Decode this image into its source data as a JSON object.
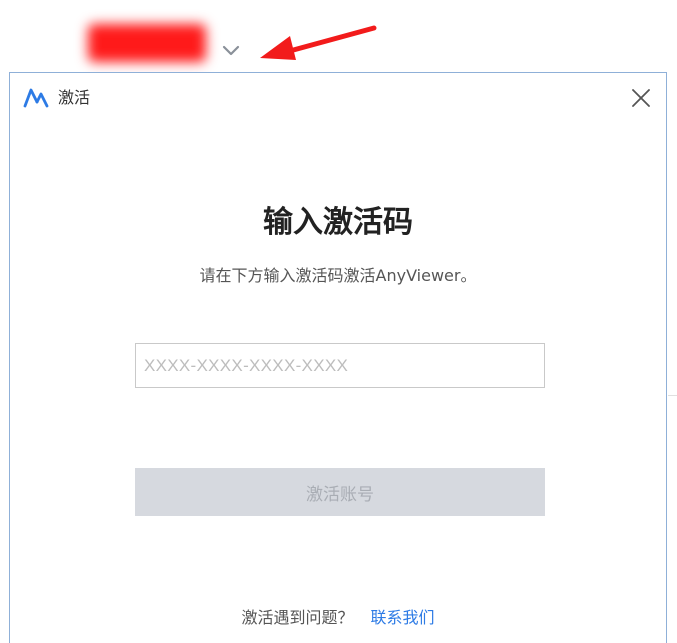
{
  "dialog": {
    "title": "激活",
    "heading": "输入激活码",
    "subtitle": "请在下方输入激活码激活AnyViewer。",
    "code_input": {
      "placeholder": "XXXX-XXXX-XXXX-XXXX",
      "value": ""
    },
    "activate_button_label": "激活账号",
    "help_text": "激活遇到问题？",
    "contact_link_label": "联系我们"
  },
  "colors": {
    "accent": "#2d7be5",
    "dialog_border": "#8fb0d8",
    "button_disabled_bg": "#d6d9df",
    "button_disabled_text": "#a9adb4",
    "annotation_red": "#ff1a1a"
  },
  "icons": {
    "app_logo": "anyviewer-logo-icon",
    "close": "close-icon",
    "dropdown": "chevron-down-icon",
    "annotation": "red-arrow-annotation"
  }
}
